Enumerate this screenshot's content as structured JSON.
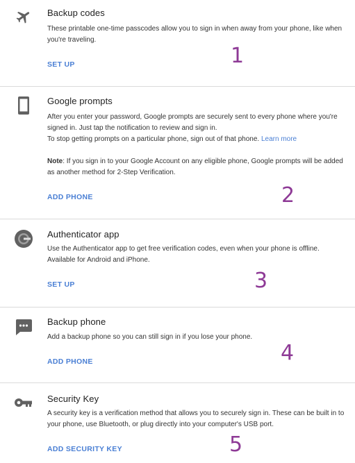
{
  "colors": {
    "accent": "#4a7fd4",
    "number": "#8e3a96",
    "icon": "#616161",
    "divider": "#dadada"
  },
  "sections": [
    {
      "icon": "airplane-icon",
      "title": "Backup codes",
      "desc": "These printable one-time passcodes allow you to sign in when away from your phone, like when you're traveling.",
      "action": "SET UP",
      "number": "1"
    },
    {
      "icon": "phone-icon",
      "title": "Google prompts",
      "desc_line1": "After you enter your password, Google prompts are securely sent to every phone where you're signed in. Just tap the notification to review and sign in.",
      "desc_line2": "To stop getting prompts on a particular phone, sign out of that phone.",
      "learn_more": "Learn more",
      "note_label": "Note",
      "note_text": ": If you sign in to your Google Account on any eligible phone, Google prompts will be added as another method for 2-Step Verification.",
      "action": "ADD PHONE",
      "number": "2"
    },
    {
      "icon": "authenticator-icon",
      "title": "Authenticator app",
      "desc": "Use the Authenticator app to get free verification codes, even when your phone is offline. Available for Android and iPhone.",
      "action": "SET UP",
      "number": "3"
    },
    {
      "icon": "message-icon",
      "title": "Backup phone",
      "desc": "Add a backup phone so you can still sign in if you lose your phone.",
      "action": "ADD PHONE",
      "number": "4"
    },
    {
      "icon": "key-icon",
      "title": "Security Key",
      "desc": "A security key is a verification method that allows you to securely sign in. These can be built in to your phone, use Bluetooth, or plug directly into your computer's USB port.",
      "action": "ADD SECURITY KEY",
      "number": "5"
    }
  ]
}
